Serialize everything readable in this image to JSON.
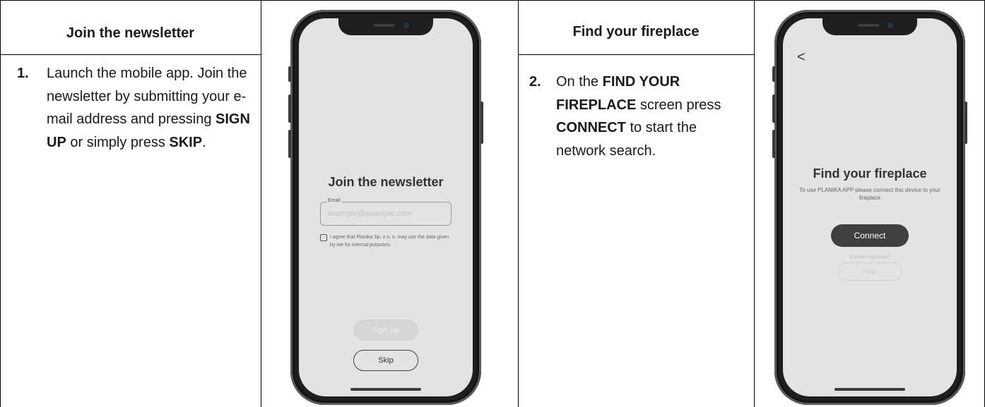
{
  "col1": {
    "header": "Join the newsletter",
    "step_number": "1.",
    "text_a": "Launch the mobile app. Join the newsletter by submitting your e-mail address and pressing ",
    "bold_a": "SIGN UP",
    "text_b": " or simply press ",
    "bold_b": "SKIP",
    "text_c": "."
  },
  "phone1": {
    "title": "Join the newsletter",
    "email_label": "Email",
    "email_placeholder": "example@example.com",
    "consent": "I agree that Planika Sp. z o. o. may use the data given by me for internal purposes.",
    "signup_label": "Sign Up",
    "skip_label": "Skip"
  },
  "col3": {
    "header": "Find your fireplace",
    "step_number": "2.",
    "text_a": "On the ",
    "bold_a": "FIND YOUR FIREPLACE",
    "text_b": " screen press ",
    "bold_b": "CONNECT",
    "text_c": " to start the network search."
  },
  "phone2": {
    "back": "<",
    "title": "Find your fireplace",
    "subtitle": "To use PLANIKA APP please connect this device to your fireplace",
    "connect_label": "Connect",
    "issues_text": "Experiencing issues?",
    "help_label": "Help"
  },
  "colors": {
    "button_dark": "#3f3f3f",
    "button_disabled": "#d6d6d6",
    "screen_bg": "#e3e3e3",
    "phone_frame": "#1e1e1e"
  }
}
